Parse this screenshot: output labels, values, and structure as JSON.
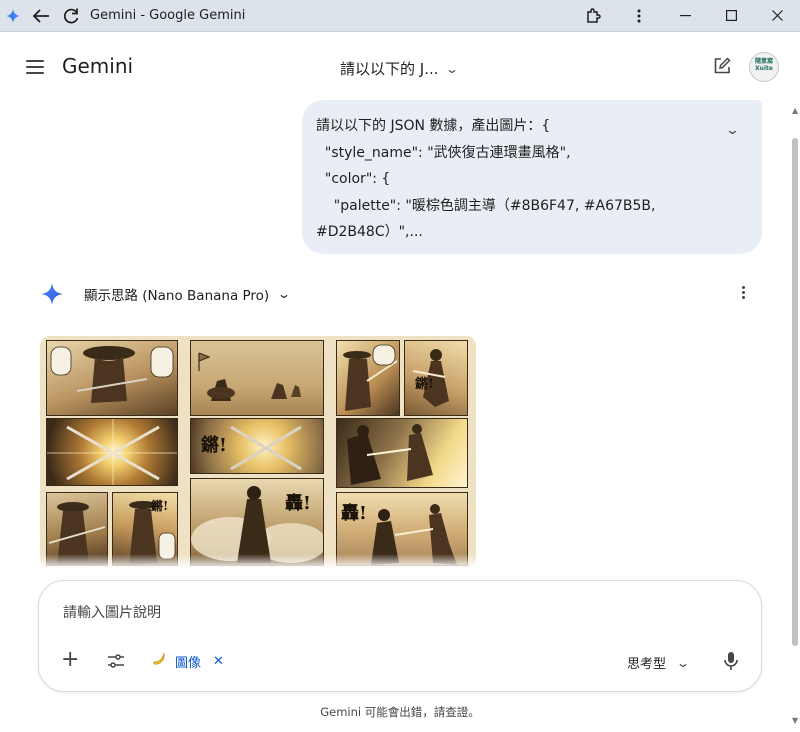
{
  "window": {
    "title": "Gemini - Google Gemini",
    "minimize_icon": "minimize-icon",
    "maximize_icon": "maximize-icon",
    "close_icon": "close-icon"
  },
  "header": {
    "brand": "Gemini",
    "conversation_title": "請以以下的 J..."
  },
  "avatar": {
    "text": "隨意窩 Xuite"
  },
  "user_message": {
    "lines": [
      "請以以下的 JSON 數據，產出圖片：{",
      "  \"style_name\": \"武俠復古連環畫風格\",",
      "  \"color\": {",
      "    \"palette\": \"暖棕色調主導（#8B6F47, #A67B5B,",
      "#D2B48C）\",..."
    ]
  },
  "model_response": {
    "thinking_label": "顯示思路 (Nano Banana Pro)",
    "comic_sfx": [
      "鏘!",
      "轟!",
      "轟!",
      "鏘!"
    ],
    "comic_colors": {
      "sepia_dark": "#3a2a18",
      "sepia_mid": "#8B6F47",
      "sepia_light": "#D2B48C",
      "gold": "#e8c066"
    }
  },
  "composer": {
    "placeholder": "請輸入圖片說明",
    "chip_label": "圖像",
    "mode_label": "思考型"
  },
  "footer": {
    "disclaimer": "Gemini 可能會出錯，請查證。"
  },
  "colors": {
    "titlebar_bg": "#dde3ea",
    "user_bubble_bg": "#e9eef6",
    "accent_blue": "#0b57d0",
    "spark_blue": "#3f7ef5"
  }
}
